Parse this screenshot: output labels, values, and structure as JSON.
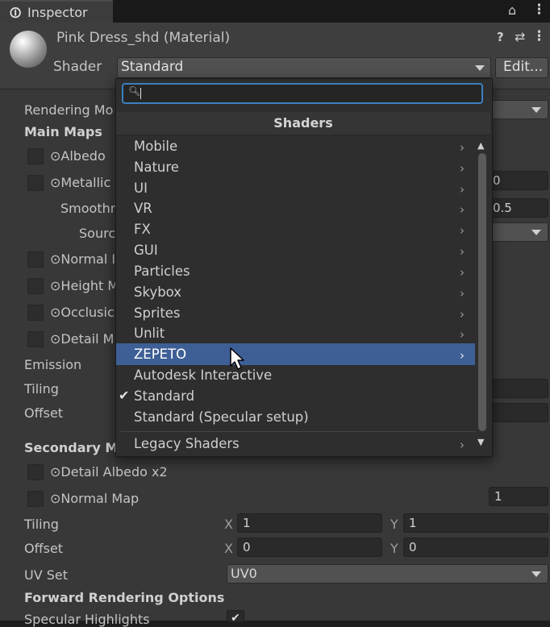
{
  "window": {
    "tab_title": "Inspector",
    "tab_icon": "info-icon",
    "lock_icon": "lock-icon",
    "menu_icon": "kebab-menu-icon"
  },
  "material": {
    "name": "Pink Dress_shd (Material)",
    "shader_label": "Shader",
    "shader_value": "Standard",
    "edit_label": "Edit...",
    "help_icon": "help-icon",
    "settings_icon": "sliders-icon",
    "menu_icon": "kebab-menu-icon"
  },
  "properties": {
    "rendering_mode": "Rendering Mo",
    "main_maps": "Main Maps",
    "albedo": "Albedo",
    "metallic": "Metallic",
    "metallic_value": "0",
    "smoothness": "Smoothr",
    "smoothness_value": "0.5",
    "source": "Sourc",
    "normal": "Normal I",
    "height": "Height M",
    "occlusion": "Occlusic",
    "detail": "Detail M",
    "emission": "Emission",
    "tiling": "Tiling",
    "offset": "Offset",
    "secondary_maps": "Secondary M",
    "detail_albedo": "Detail Albedo x2",
    "normal_map": "Normal Map",
    "normal_map_value": "1",
    "tiling2": "Tiling",
    "tiling_x_label": "X",
    "tiling_x": "1",
    "tiling_y_label": "Y",
    "tiling_y": "1",
    "offset2": "Offset",
    "offset_x_label": "X",
    "offset_x": "0",
    "offset_y_label": "Y",
    "offset_y": "0",
    "uv_set": "UV Set",
    "uv_set_value": "UV0",
    "forward_options": "Forward Rendering Options",
    "specular_highlights": "Specular Highlights"
  },
  "shader_popup": {
    "search_value": "",
    "title": "Shaders",
    "items": [
      {
        "label": "Mobile",
        "submenu": true
      },
      {
        "label": "Nature",
        "submenu": true
      },
      {
        "label": "UI",
        "submenu": true
      },
      {
        "label": "VR",
        "submenu": true
      },
      {
        "label": "FX",
        "submenu": true
      },
      {
        "label": "GUI",
        "submenu": true
      },
      {
        "label": "Particles",
        "submenu": true
      },
      {
        "label": "Skybox",
        "submenu": true
      },
      {
        "label": "Sprites",
        "submenu": true
      },
      {
        "label": "Unlit",
        "submenu": true
      },
      {
        "label": "ZEPETO",
        "submenu": true,
        "highlighted": true
      },
      {
        "label": "Autodesk Interactive",
        "submenu": false
      },
      {
        "label": "Standard",
        "submenu": false,
        "checked": true
      },
      {
        "label": "Standard (Specular setup)",
        "submenu": false
      }
    ],
    "legacy": "Legacy Shaders",
    "highlight_color": "#3e5f96",
    "search_border_color": "#3c7fc0"
  }
}
